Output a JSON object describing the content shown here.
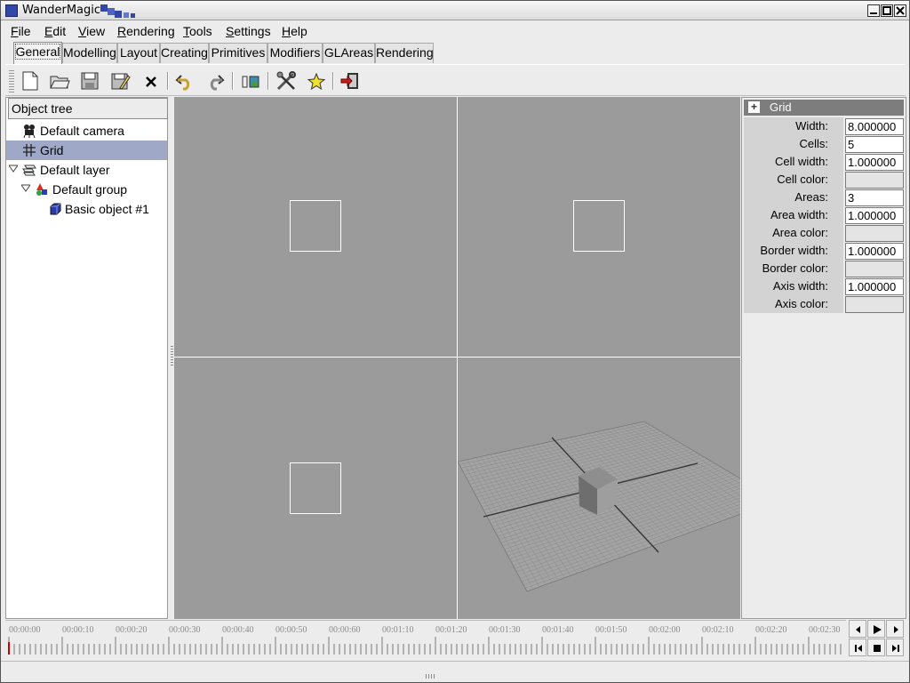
{
  "window": {
    "title": "WanderMagic",
    "buttons": {
      "minimize": "_",
      "maximize": "□",
      "close": "×"
    }
  },
  "menu": {
    "items": [
      {
        "name": "file",
        "first": "F",
        "rest": "ile"
      },
      {
        "name": "edit",
        "first": "E",
        "rest": "dit"
      },
      {
        "name": "view",
        "first": "V",
        "rest": "iew"
      },
      {
        "name": "rendering",
        "first": "R",
        "rest": "endering"
      },
      {
        "name": "tools",
        "first": "T",
        "rest": "ools"
      },
      {
        "name": "settings",
        "first": "S",
        "rest": "ettings"
      },
      {
        "name": "help",
        "first": "H",
        "rest": "elp"
      }
    ]
  },
  "tabs": [
    "General",
    "Modelling",
    "Layout",
    "Creating",
    "Primitives",
    "Modifiers",
    "GLAreas",
    "Rendering"
  ],
  "active_tab": "General",
  "toolbar": {
    "icons": [
      "new-file-icon",
      "open-folder-icon",
      "save-icon",
      "save-as-icon",
      "delete-icon",
      "undo-icon",
      "redo-icon",
      "render-image-icon",
      "tools-icon",
      "favorite-star-icon",
      "exit-icon"
    ]
  },
  "tree": {
    "header": "Object tree",
    "nodes": [
      {
        "label": "Default camera",
        "icon": "camera-icon",
        "selected": false
      },
      {
        "label": "Grid",
        "icon": "grid-icon",
        "selected": true
      },
      {
        "label": "Default layer",
        "icon": "layer-icon",
        "selected": false,
        "expanded": true
      },
      {
        "label": "Default group",
        "icon": "group-icon",
        "selected": false,
        "expanded": true
      },
      {
        "label": "Basic object #1",
        "icon": "cube-icon",
        "selected": false
      }
    ]
  },
  "properties": {
    "title": "Grid",
    "expand_symbol": "+",
    "rows": [
      {
        "label": "Width:",
        "value": "8.000000",
        "type": "text"
      },
      {
        "label": "Cells:",
        "value": "5",
        "type": "text"
      },
      {
        "label": "Cell width:",
        "value": "1.000000",
        "type": "text"
      },
      {
        "label": "Cell color:",
        "value": "",
        "type": "color"
      },
      {
        "label": "Areas:",
        "value": "3",
        "type": "text"
      },
      {
        "label": "Area width:",
        "value": "1.000000",
        "type": "text"
      },
      {
        "label": "Area color:",
        "value": "",
        "type": "color"
      },
      {
        "label": "Border width:",
        "value": "1.000000",
        "type": "text"
      },
      {
        "label": "Border color:",
        "value": "",
        "type": "color"
      },
      {
        "label": "Axis width:",
        "value": "1.000000",
        "type": "text"
      },
      {
        "label": "Axis color:",
        "value": "",
        "type": "color"
      }
    ]
  },
  "timeline": {
    "labels": [
      "00:00:00",
      "00:00:10",
      "00:00:20",
      "00:00:30",
      "00:00:40",
      "00:00:50",
      "00:00:60",
      "00:01:10",
      "00:01:20",
      "00:01:30",
      "00:01:40",
      "00:01:50",
      "00:02:00",
      "00:02:10",
      "00:02:20",
      "00:02:30"
    ],
    "controls": [
      "step-back-icon",
      "play-icon",
      "step-forward-icon",
      "go-start-icon",
      "stop-icon",
      "go-end-icon"
    ]
  },
  "colors": {
    "viewport_bg": "#9b9b9b",
    "selection": "#9fa9c7",
    "panel_header": "#7d7d7d",
    "playhead": "#c80000"
  }
}
